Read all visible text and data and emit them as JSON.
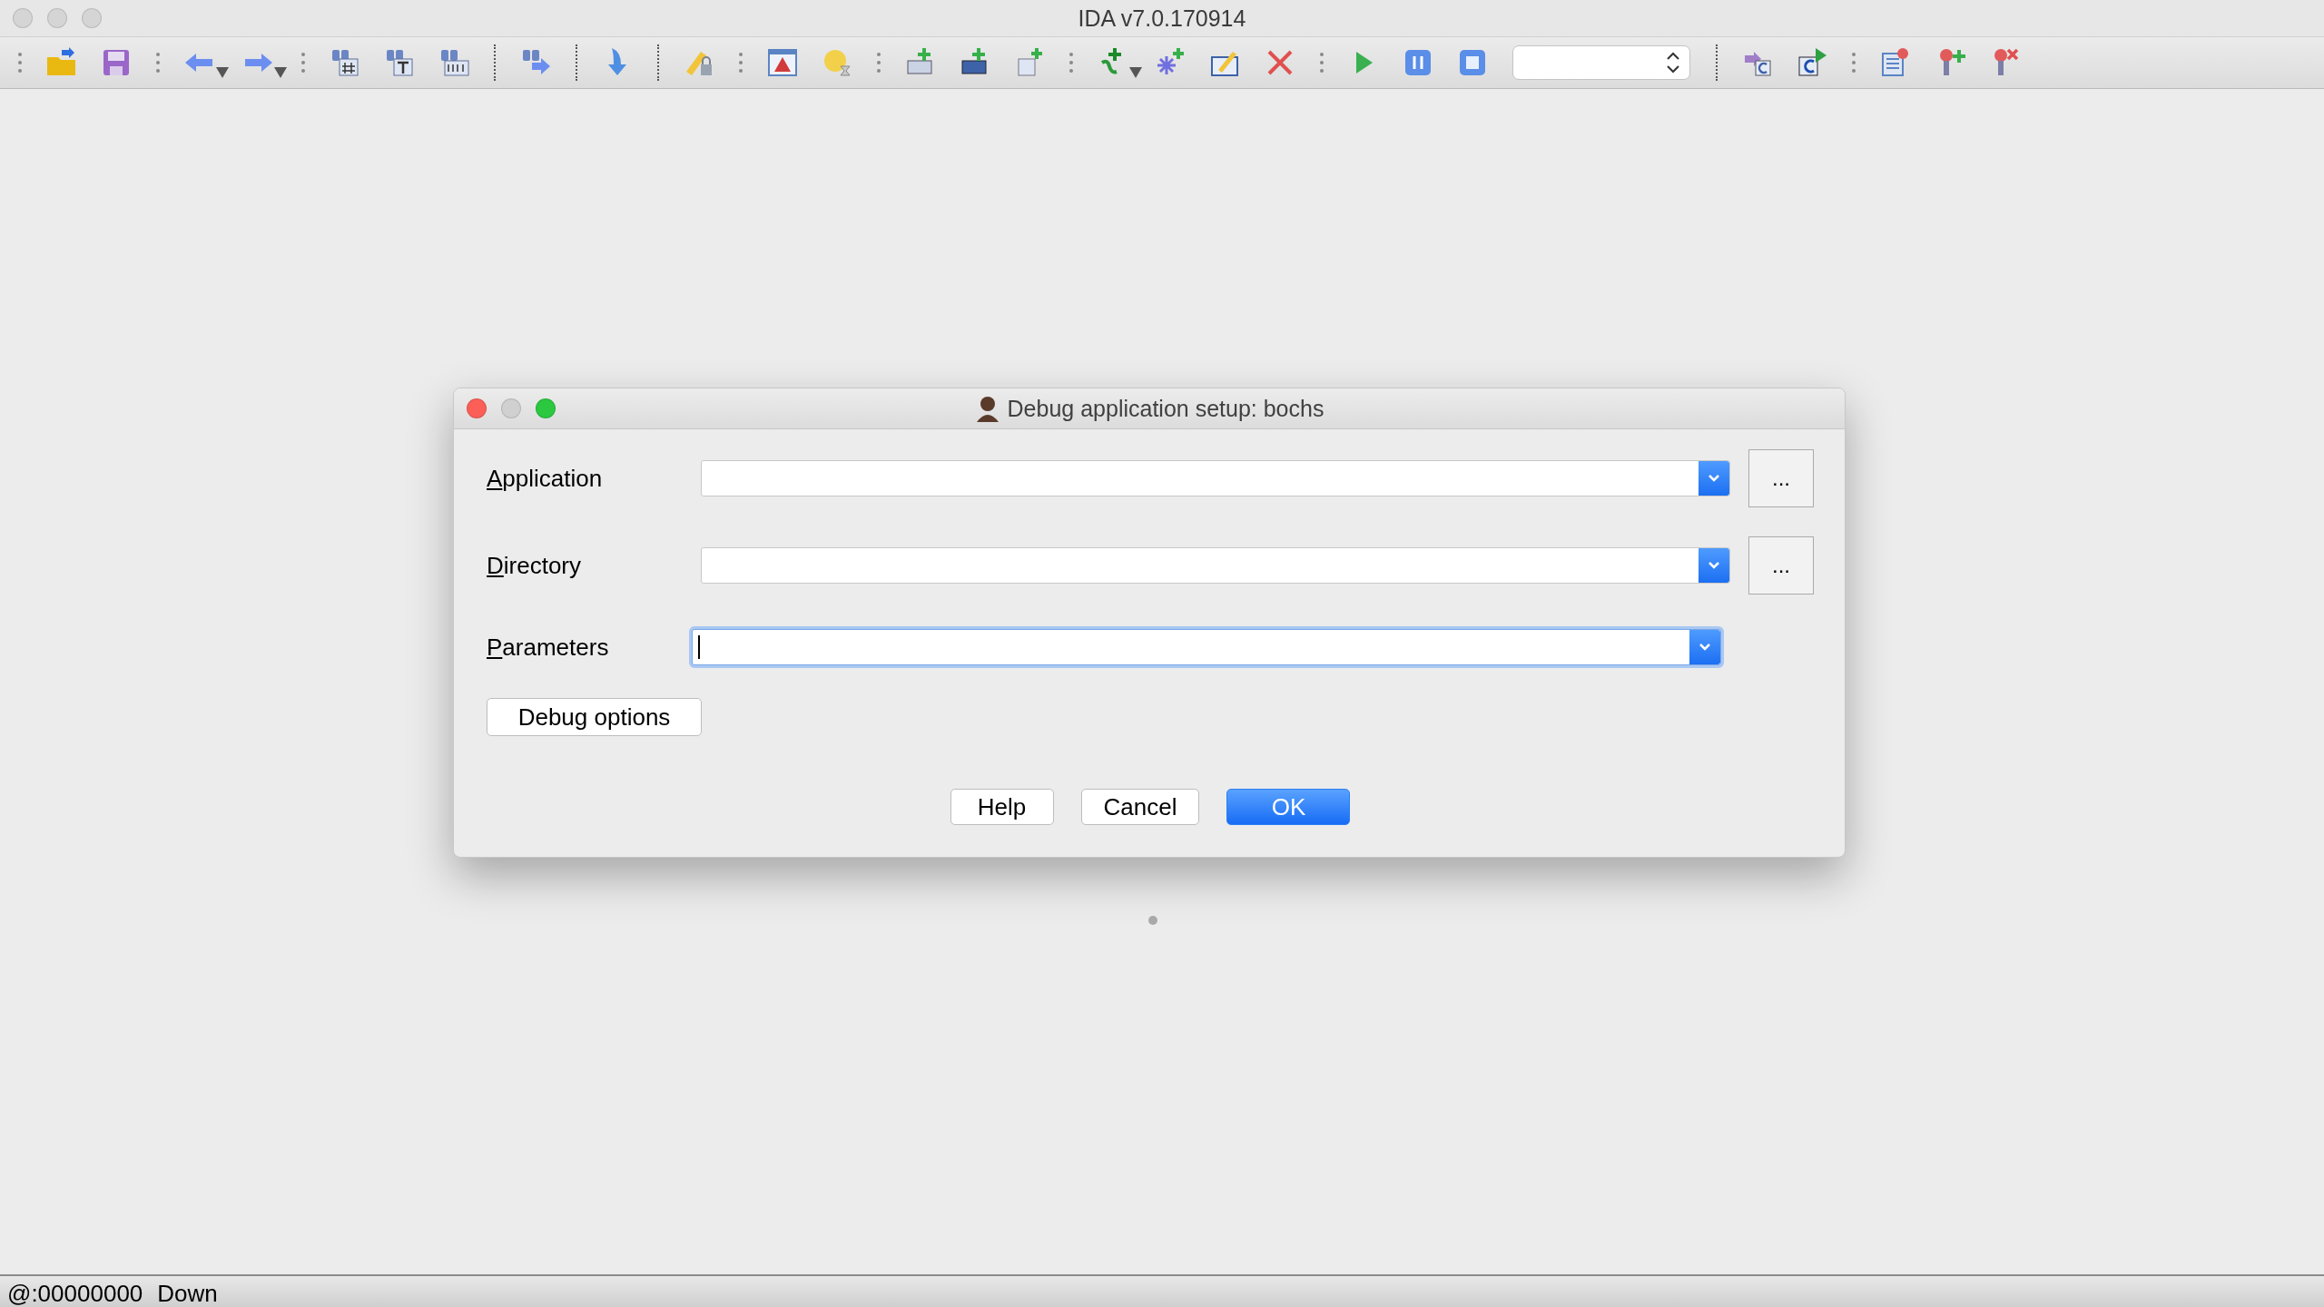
{
  "window": {
    "title": "IDA v7.0.170914"
  },
  "dialog": {
    "title": "Debug application setup: bochs",
    "fields": [
      {
        "label": "Application",
        "browse_button": "...",
        "focused": false
      },
      {
        "label": "Directory",
        "browse_button": "...",
        "focused": false
      },
      {
        "label": "Parameters",
        "focused": true
      }
    ],
    "options_button": "Debug options",
    "buttons": [
      {
        "label": "Help",
        "default": false
      },
      {
        "label": "Cancel",
        "default": false
      },
      {
        "label": "OK",
        "default": true
      }
    ]
  },
  "status_bar": {
    "address": "@:00000000",
    "state": "Down"
  }
}
